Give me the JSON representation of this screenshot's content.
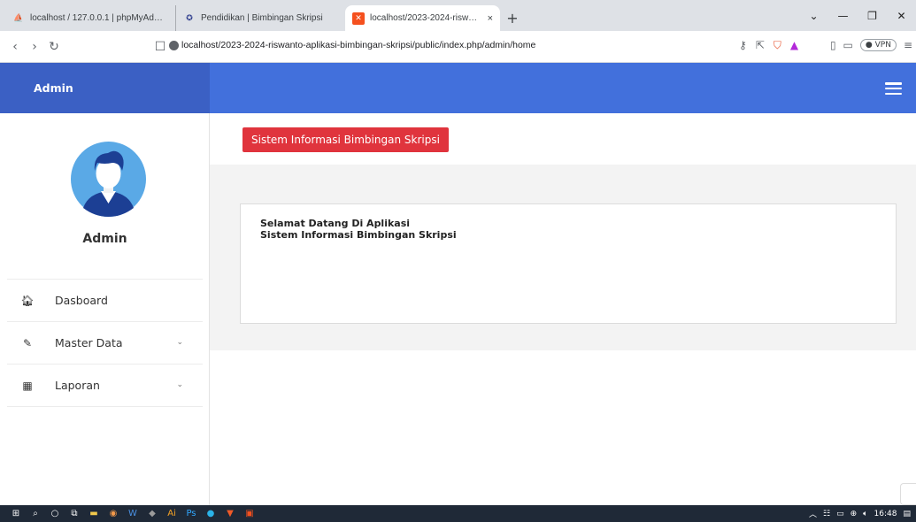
{
  "browser": {
    "tabs": [
      {
        "title": "localhost / 127.0.0.1 | phpMyAdmin",
        "active": false
      },
      {
        "title": "Pendidikan | Bimbingan Skripsi",
        "active": false
      },
      {
        "title": "localhost/2023-2024-riswanto-a",
        "active": true
      }
    ],
    "new_tab_symbol": "+",
    "close_symbol": "×",
    "url": "localhost/2023-2024-riswanto-aplikasi-bimbingan-skripsi/public/index.php/admin/home",
    "vpn_label": "VPN"
  },
  "app": {
    "brand_label": "Admin",
    "page_badge": "Sistem Informasi Bimbingan Skripsi",
    "user_name": "Admin",
    "welcome_line1": "Selamat Datang Di Aplikasi",
    "welcome_line2": "Sistem Informasi Bimbingan Skripsi",
    "menu": [
      {
        "label": "Dasboard",
        "icon": "home-icon",
        "expandable": false
      },
      {
        "label": "Master Data",
        "icon": "edit-icon",
        "expandable": true
      },
      {
        "label": "Laporan",
        "icon": "calendar-icon",
        "expandable": true
      }
    ]
  },
  "taskbar": {
    "time": "16:48"
  },
  "colors": {
    "sidebar_header": "#3b60c4",
    "topbar": "#4270dc",
    "badge": "#e0343d",
    "avatar_bg": "#5aa9e6"
  }
}
